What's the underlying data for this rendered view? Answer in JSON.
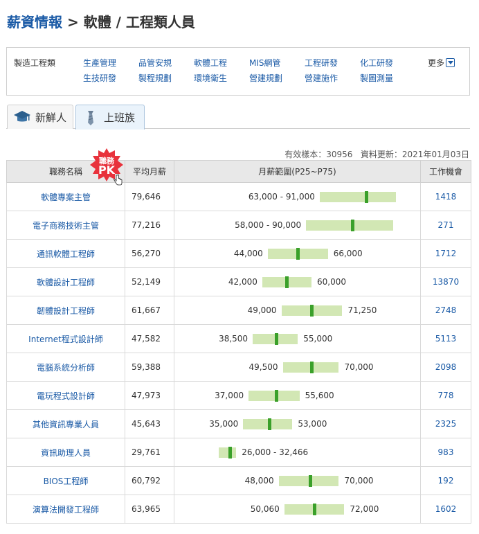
{
  "header": {
    "category": "薪資情報",
    "separator": ">",
    "subcategory": "軟體 / 工程類人員"
  },
  "filter": {
    "category_label": "製造工程類",
    "links": [
      "生產管理",
      "品管安規",
      "軟體工程",
      "MIS網管",
      "工程研發",
      "化工研發",
      "生技研發",
      "製程規劃",
      "環境衛生",
      "營建規劃",
      "營建施作",
      "製圖測量"
    ],
    "more_label": "更多"
  },
  "tabs": [
    {
      "label": "新鮮人",
      "icon": "graduation-cap-icon"
    },
    {
      "label": "上班族",
      "icon": "necktie-icon"
    }
  ],
  "meta": {
    "samples": "有效樣本：30956",
    "updated": "資料更新：2021年01月03日"
  },
  "table": {
    "headers": [
      "職務名稱",
      "平均月薪",
      "月薪範圍(P25~P75)",
      "工作機會"
    ],
    "pk_badge": {
      "line1": "職務",
      "line2": "PK"
    },
    "rows": [
      {
        "job": "軟體專案主管",
        "avg": "79,646",
        "p25": 63000,
        "p75": 91000,
        "median": 80000,
        "low_text": "63,000 - 91,000",
        "high_text": "",
        "count": "1418"
      },
      {
        "job": "電子商務技術主管",
        "avg": "77,216",
        "p25": 58000,
        "p75": 90000,
        "median": 75000,
        "low_text": "58,000 - 90,000",
        "high_text": "",
        "count": "271"
      },
      {
        "job": "通訊軟體工程師",
        "avg": "56,270",
        "p25": 44000,
        "p75": 66000,
        "median": 55000,
        "low_text": "44,000",
        "high_text": "66,000",
        "count": "1712"
      },
      {
        "job": "軟體設計工程師",
        "avg": "52,149",
        "p25": 42000,
        "p75": 60000,
        "median": 51000,
        "low_text": "42,000",
        "high_text": "60,000",
        "count": "13870"
      },
      {
        "job": "韌體設計工程師",
        "avg": "61,667",
        "p25": 49000,
        "p75": 71250,
        "median": 60000,
        "low_text": "49,000",
        "high_text": "71,250",
        "count": "2748"
      },
      {
        "job": "Internet程式設計師",
        "avg": "47,582",
        "p25": 38500,
        "p75": 55000,
        "median": 47000,
        "low_text": "38,500",
        "high_text": "55,000",
        "count": "5113"
      },
      {
        "job": "電腦系統分析師",
        "avg": "59,388",
        "p25": 49500,
        "p75": 70000,
        "median": 60000,
        "low_text": "49,500",
        "high_text": "70,000",
        "count": "2098"
      },
      {
        "job": "電玩程式設計師",
        "avg": "47,973",
        "p25": 37000,
        "p75": 55600,
        "median": 47000,
        "low_text": "37,000",
        "high_text": "55,600",
        "count": "778"
      },
      {
        "job": "其他資訊專業人員",
        "avg": "45,643",
        "p25": 35000,
        "p75": 53000,
        "median": 44500,
        "low_text": "35,000",
        "high_text": "53,000",
        "count": "2325"
      },
      {
        "job": "資訊助理人員",
        "avg": "29,761",
        "p25": 26000,
        "p75": 32466,
        "median": 30000,
        "low_text": "",
        "high_text": "26,000 - 32,466",
        "count": "983"
      },
      {
        "job": "BIOS工程師",
        "avg": "60,792",
        "p25": 48000,
        "p75": 70000,
        "median": 59500,
        "low_text": "48,000",
        "high_text": "70,000",
        "count": "192"
      },
      {
        "job": "演算法開發工程師",
        "avg": "63,965",
        "p25": 50060,
        "p75": 72000,
        "median": 61000,
        "low_text": "50,060",
        "high_text": "72,000",
        "count": "1602"
      }
    ]
  },
  "colors": {
    "link": "#1a5aa6",
    "bar": "#d2e7b4",
    "median": "#3aa02a",
    "badge": "#e8323c"
  }
}
